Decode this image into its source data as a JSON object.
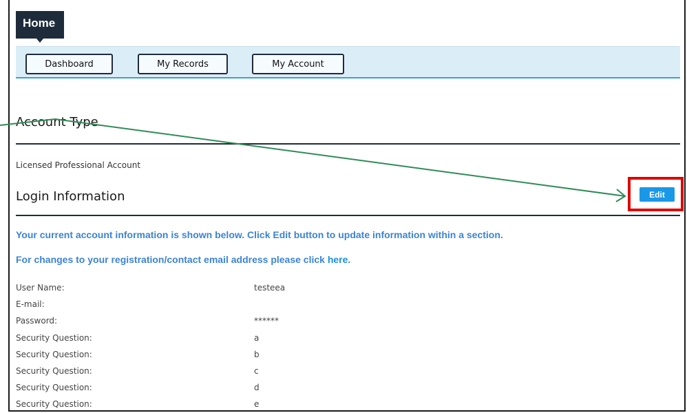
{
  "home_tab": {
    "label": "Home"
  },
  "nav": {
    "items": [
      {
        "label": "Dashboard"
      },
      {
        "label": "My Records"
      },
      {
        "label": "My Account"
      }
    ]
  },
  "account_type": {
    "title": "Account Type",
    "value": "Licensed Professional Account"
  },
  "login_info": {
    "title": "Login Information",
    "edit_label": "Edit",
    "notice_1": "Your current account information is shown below. Click Edit button to update information within a section.",
    "notice_2_prefix": "For changes to your registration/contact email address please click ",
    "notice_2_link": "here",
    "notice_2_suffix": ".",
    "rows": [
      {
        "label": "User Name:",
        "value": "testeea"
      },
      {
        "label": "E-mail:",
        "value": ""
      },
      {
        "label": "Password:",
        "value": "******"
      },
      {
        "label": "Security Question:",
        "value": "a"
      },
      {
        "label": "Security Question:",
        "value": "b"
      },
      {
        "label": "Security Question:",
        "value": "c"
      },
      {
        "label": "Security Question:",
        "value": "d"
      },
      {
        "label": "Security Question:",
        "value": "e"
      }
    ]
  },
  "colors": {
    "accent": "#1a98e8",
    "highlight": "#e00000",
    "arrow": "#2e8b57",
    "nav_bg": "#dbeef8"
  }
}
